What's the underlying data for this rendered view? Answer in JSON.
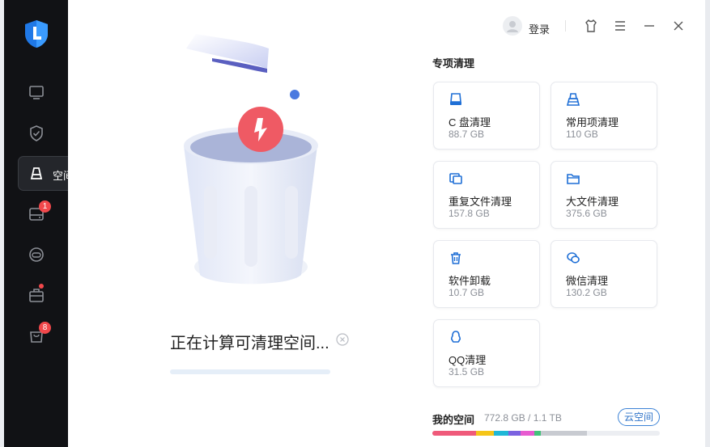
{
  "sidebar": {
    "tooltip_label": "空间清理",
    "badges": {
      "drive": "1",
      "box": "8"
    }
  },
  "topbar": {
    "login_label": "登录"
  },
  "scan": {
    "status_text": "正在计算可清理空间...",
    "progress": 0.0
  },
  "special_clean": {
    "title": "专项清理",
    "items": [
      {
        "name": "C 盘清理",
        "size": "88.7 GB",
        "icon": "drive-icon"
      },
      {
        "name": "常用项清理",
        "size": "110 GB",
        "icon": "broom-icon"
      },
      {
        "name": "重复文件清理",
        "size": "157.8 GB",
        "icon": "duplicate-files-icon"
      },
      {
        "name": "大文件清理",
        "size": "375.6 GB",
        "icon": "folder-icon"
      },
      {
        "name": "软件卸载",
        "size": "10.7 GB",
        "icon": "trash-icon"
      },
      {
        "name": "微信清理",
        "size": "130.2 GB",
        "icon": "wechat-icon"
      },
      {
        "name": "QQ清理",
        "size": "31.5 GB",
        "icon": "qq-icon"
      }
    ]
  },
  "space": {
    "label": "我的空间",
    "value": "772.8 GB / 1.1 TB",
    "cloud_button": "云空间",
    "used_fraction": 0.68,
    "segment_colors": [
      "#ef5a7a",
      "#f5c518",
      "#1fb7d6",
      "#7b62e0",
      "#e75bd0",
      "#42c27a",
      "#c8cbd1"
    ]
  },
  "colors": {
    "accent": "#2f74c9",
    "sidebar_bg": "#111215",
    "badge": "#f2484b"
  }
}
